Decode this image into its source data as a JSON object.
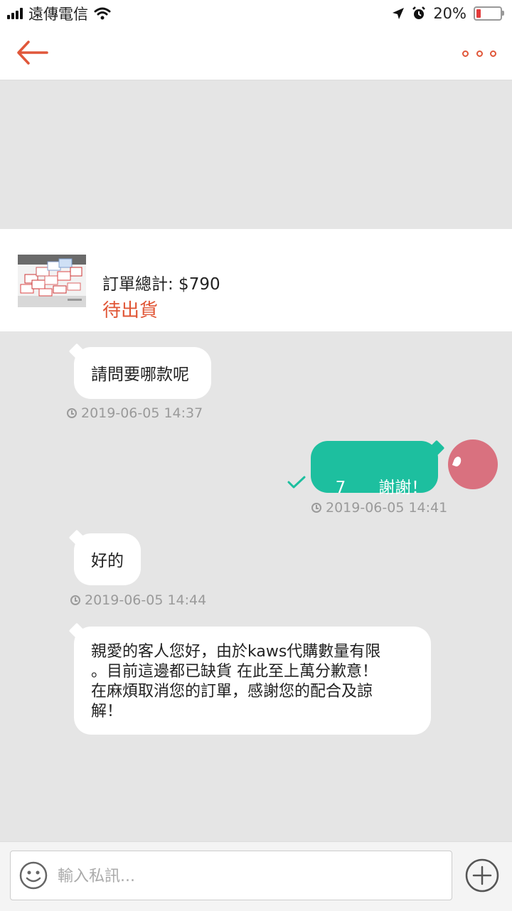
{
  "status_bar": {
    "carrier": "遠傳電信",
    "battery": "20%"
  },
  "order": {
    "total": "訂單總計: $790",
    "status": "待出貨"
  },
  "messages": [
    {
      "text": "請問要哪款呢",
      "time": "2019-06-05 14:37"
    },
    {
      "text": "7　　謝謝！",
      "time": "2019-06-05 14:41"
    },
    {
      "text": "好的",
      "time": "2019-06-05 14:44"
    },
    {
      "lines": [
        "親愛的客人您好，由於kaws代購數量有限",
        "。目前這邊都已缺貨 在此至上萬分歉意！",
        "在麻煩取消您的訂單，感謝您的配合及諒",
        "解！"
      ]
    }
  ],
  "input": {
    "placeholder": "輸入私訊..."
  },
  "colors": {
    "accent": "#e0573a",
    "sent_bubble": "#1dbf9f",
    "status": "#e05535"
  },
  "icons": [
    "back-arrow-icon",
    "more-icon",
    "clock-icon",
    "check-icon",
    "emoji-icon",
    "plus-icon"
  ]
}
